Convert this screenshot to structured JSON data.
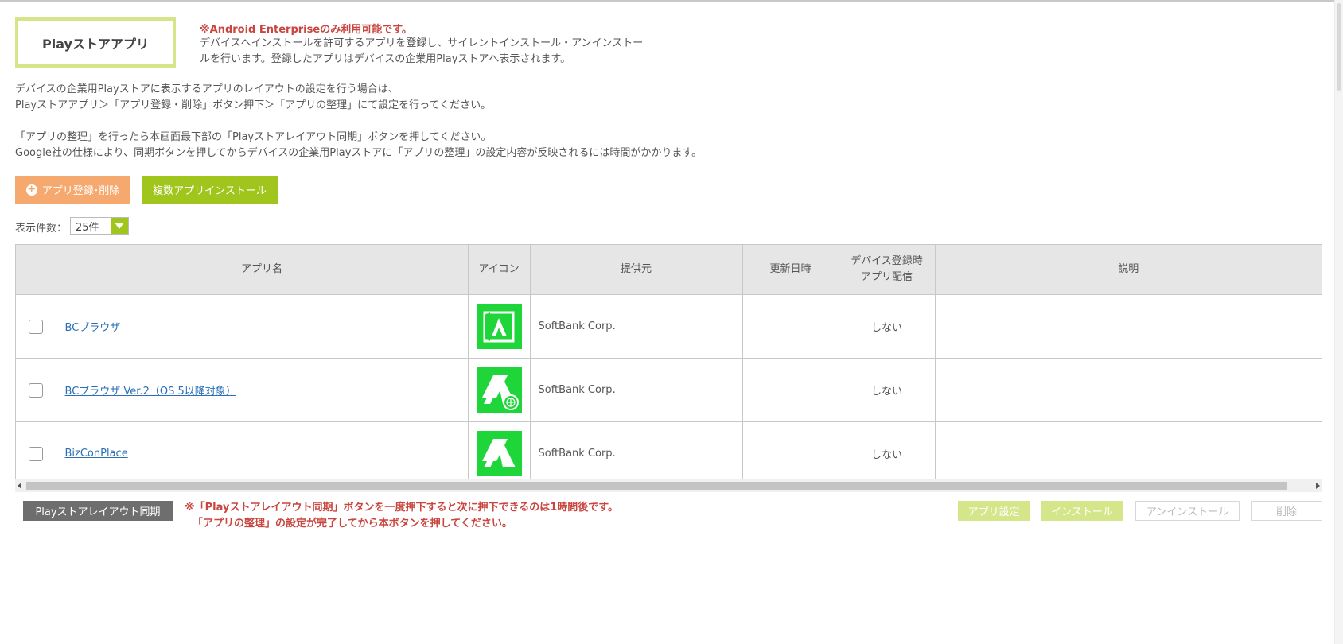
{
  "header": {
    "title": "Playストアアプリ",
    "notice": "※Android Enterpriseのみ利用可能です。",
    "description": "デバイスへインストールを許可するアプリを登録し、サイレントインストール・アンインストールを行います。登録したアプリはデバイスの企業用Playストアへ表示されます。"
  },
  "info": {
    "line1": "デバイスの企業用Playストアに表示するアプリのレイアウトの設定を行う場合は、",
    "line2": "Playストアアプリ＞「アプリ登録・削除」ボタン押下＞「アプリの整理」にて設定を行ってください。",
    "line3": "「アプリの整理」を行ったら本画面最下部の「Playストアレイアウト同期」ボタンを押してください。",
    "line4": "Google社の仕様により、同期ボタンを押してからデバイスの企業用Playストアに「アプリの整理」の設定内容が反映されるには時間がかかります。"
  },
  "toolbar": {
    "register_label": "アプリ登録･削除",
    "bulk_install_label": "複数アプリインストール",
    "perpage_label": "表示件数：",
    "perpage_value": "25件"
  },
  "table": {
    "headers": {
      "app_name": "アプリ名",
      "icon": "アイコン",
      "provider": "提供元",
      "updated": "更新日時",
      "deploy_line1": "デバイス登録時",
      "deploy_line2": "アプリ配信",
      "description": "説明"
    },
    "rows": [
      {
        "name": "BCブラウザ",
        "provider": "SoftBank Corp.",
        "updated": "",
        "deploy": "しない",
        "description": "",
        "icon": "bc-browser-icon"
      },
      {
        "name": "BCブラウザ Ver.2（OS 5以降対象）",
        "provider": "SoftBank Corp.",
        "updated": "",
        "deploy": "しない",
        "description": "",
        "icon": "bc-browser-v2-icon"
      },
      {
        "name": "BizConPlace",
        "provider": "SoftBank Corp.",
        "updated": "",
        "deploy": "しない",
        "description": "",
        "icon": "bizconplace-icon"
      }
    ]
  },
  "footer": {
    "sync_label": "Playストアレイアウト同期",
    "sync_note1": "※「Playストアレイアウト同期」ボタンを一度押下すると次に押下できるのは1時間後です。",
    "sync_note2": "「アプリの整理」の設定が完了してから本ボタンを押してください。",
    "app_settings_label": "アプリ設定",
    "install_label": "インストール",
    "uninstall_label": "アンインストール",
    "delete_label": "削除"
  },
  "colors": {
    "accent_green": "#a0c51c",
    "light_green": "#d4e58a",
    "orange": "#f6a96e",
    "alert_red": "#c9453f",
    "icon_green": "#1fd63a",
    "link_blue": "#2a6fb5"
  }
}
